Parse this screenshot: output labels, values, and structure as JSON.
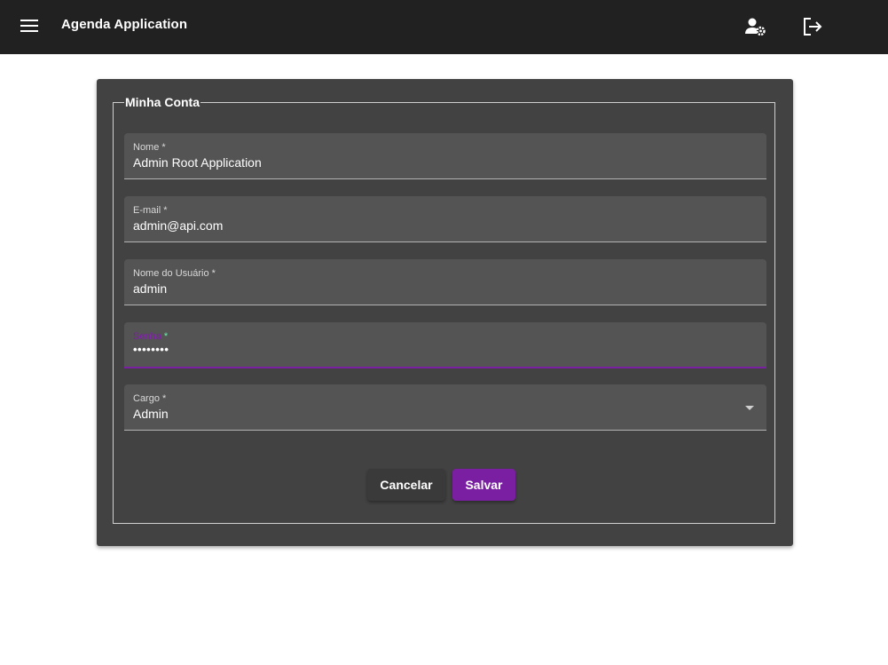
{
  "toolbar": {
    "title": "Agenda Application",
    "menu_icon": "menu-icon",
    "account_icon": "user-settings-icon",
    "logout_icon": "logout-icon",
    "background": "#212121"
  },
  "form": {
    "legend": "Minha Conta",
    "fields": [
      {
        "label": "Nome",
        "required": "*",
        "value": "Admin Root Application"
      },
      {
        "label": "E-mail",
        "required": "*",
        "value": "admin@api.com"
      },
      {
        "label": "Nome do Usuário",
        "required": "*",
        "value": "admin"
      },
      {
        "label": "Senha",
        "required": "*",
        "value": "••••••••"
      },
      {
        "label": "Cargo",
        "required": "*",
        "value": "Admin"
      }
    ],
    "cancel_label": "Cancelar",
    "save_label": "Salvar"
  },
  "colors": {
    "accent": "#7b1fa2",
    "card": "#424242",
    "field": "#545454",
    "required_focus": "#69f0ae"
  }
}
